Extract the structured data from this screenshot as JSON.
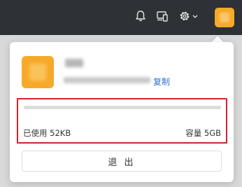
{
  "topbar": {
    "icons": [
      "bell-icon",
      "devices-icon",
      "gear-icon",
      "chevron-down-icon",
      "avatar"
    ]
  },
  "account": {
    "copy_label": "复制"
  },
  "storage": {
    "used_label": "已使用 52KB",
    "capacity_label": "容量 5GB",
    "used_fraction": 1e-05
  },
  "logout_label": "退 出",
  "colors": {
    "topbar_bg": "#2e3136",
    "avatar_bg": "#f7a928",
    "link": "#2f6fd1",
    "highlight_border": "#d2232a"
  }
}
